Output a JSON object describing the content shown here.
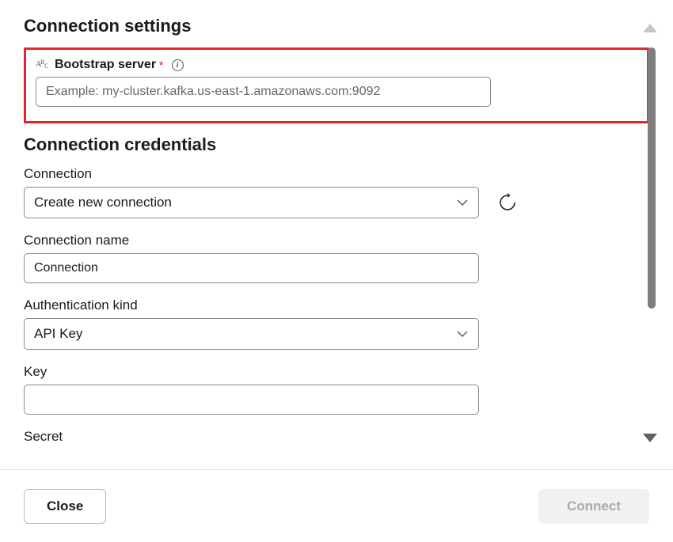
{
  "sections": {
    "settings_heading": "Connection settings",
    "credentials_heading": "Connection credentials"
  },
  "bootstrap": {
    "label": "Bootstrap server",
    "required_marker": "*",
    "placeholder": "Example: my-cluster.kafka.us-east-1.amazonaws.com:9092",
    "value": ""
  },
  "connection": {
    "label": "Connection",
    "selected": "Create new connection"
  },
  "connection_name": {
    "label": "Connection name",
    "value": "Connection"
  },
  "auth_kind": {
    "label": "Authentication kind",
    "selected": "API Key"
  },
  "key": {
    "label": "Key",
    "value": ""
  },
  "secret": {
    "label": "Secret",
    "value": ""
  },
  "footer": {
    "close_label": "Close",
    "connect_label": "Connect"
  },
  "info_glyph": "i"
}
